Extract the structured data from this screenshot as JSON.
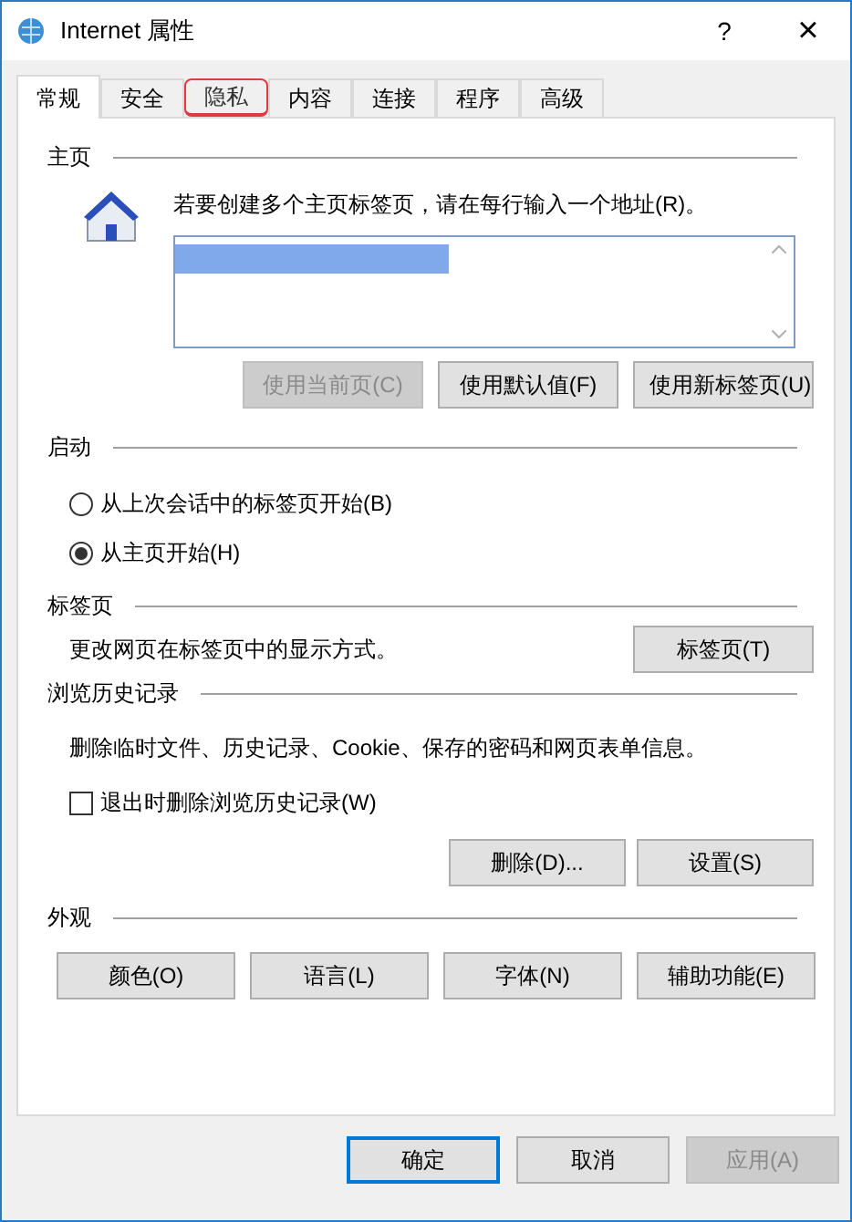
{
  "window": {
    "title": "Internet 属性",
    "help": "?",
    "close": "×"
  },
  "tabs": [
    {
      "label": "常规",
      "selected": true,
      "highlighted": false
    },
    {
      "label": "安全",
      "selected": false,
      "highlighted": false
    },
    {
      "label": "隐私",
      "selected": false,
      "highlighted": true
    },
    {
      "label": "内容",
      "selected": false,
      "highlighted": false
    },
    {
      "label": "连接",
      "selected": false,
      "highlighted": false
    },
    {
      "label": "程序",
      "selected": false,
      "highlighted": false
    },
    {
      "label": "高级",
      "selected": false,
      "highlighted": false
    }
  ],
  "homepage": {
    "heading": "主页",
    "instruction": "若要创建多个主页标签页，请在每行输入一个地址(R)。",
    "addresses": {
      "redacted": true
    },
    "buttons": [
      {
        "label": "使用当前页(C)",
        "disabled": true
      },
      {
        "label": "使用默认值(F)",
        "disabled": false
      },
      {
        "label": "使用新标签页(U)",
        "disabled": false
      }
    ]
  },
  "startup": {
    "heading": "启动",
    "options": [
      {
        "label": "从上次会话中的标签页开始(B)",
        "selected": false
      },
      {
        "label": "从主页开始(H)",
        "selected": true
      }
    ]
  },
  "tabs_section": {
    "heading": "标签页",
    "description": "更改网页在标签页中的显示方式。",
    "button": "标签页(T)"
  },
  "history": {
    "heading": "浏览历史记录",
    "description": "删除临时文件、历史记录、Cookie、保存的密码和网页表单信息。",
    "checkbox": {
      "label": "退出时删除浏览历史记录(W)",
      "checked": false
    },
    "buttons": [
      {
        "label": "删除(D)...",
        "disabled": false
      },
      {
        "label": "设置(S)",
        "disabled": false
      }
    ]
  },
  "appearance": {
    "heading": "外观",
    "buttons": [
      {
        "label": "颜色(O)",
        "disabled": false
      },
      {
        "label": "语言(L)",
        "disabled": false
      },
      {
        "label": "字体(N)",
        "disabled": false
      },
      {
        "label": "辅助功能(E)",
        "disabled": false
      }
    ]
  },
  "footer": {
    "buttons": [
      {
        "label": "确定",
        "disabled": false,
        "default": true
      },
      {
        "label": "取消",
        "disabled": false,
        "default": false
      },
      {
        "label": "应用(A)",
        "disabled": true,
        "default": false
      }
    ]
  }
}
